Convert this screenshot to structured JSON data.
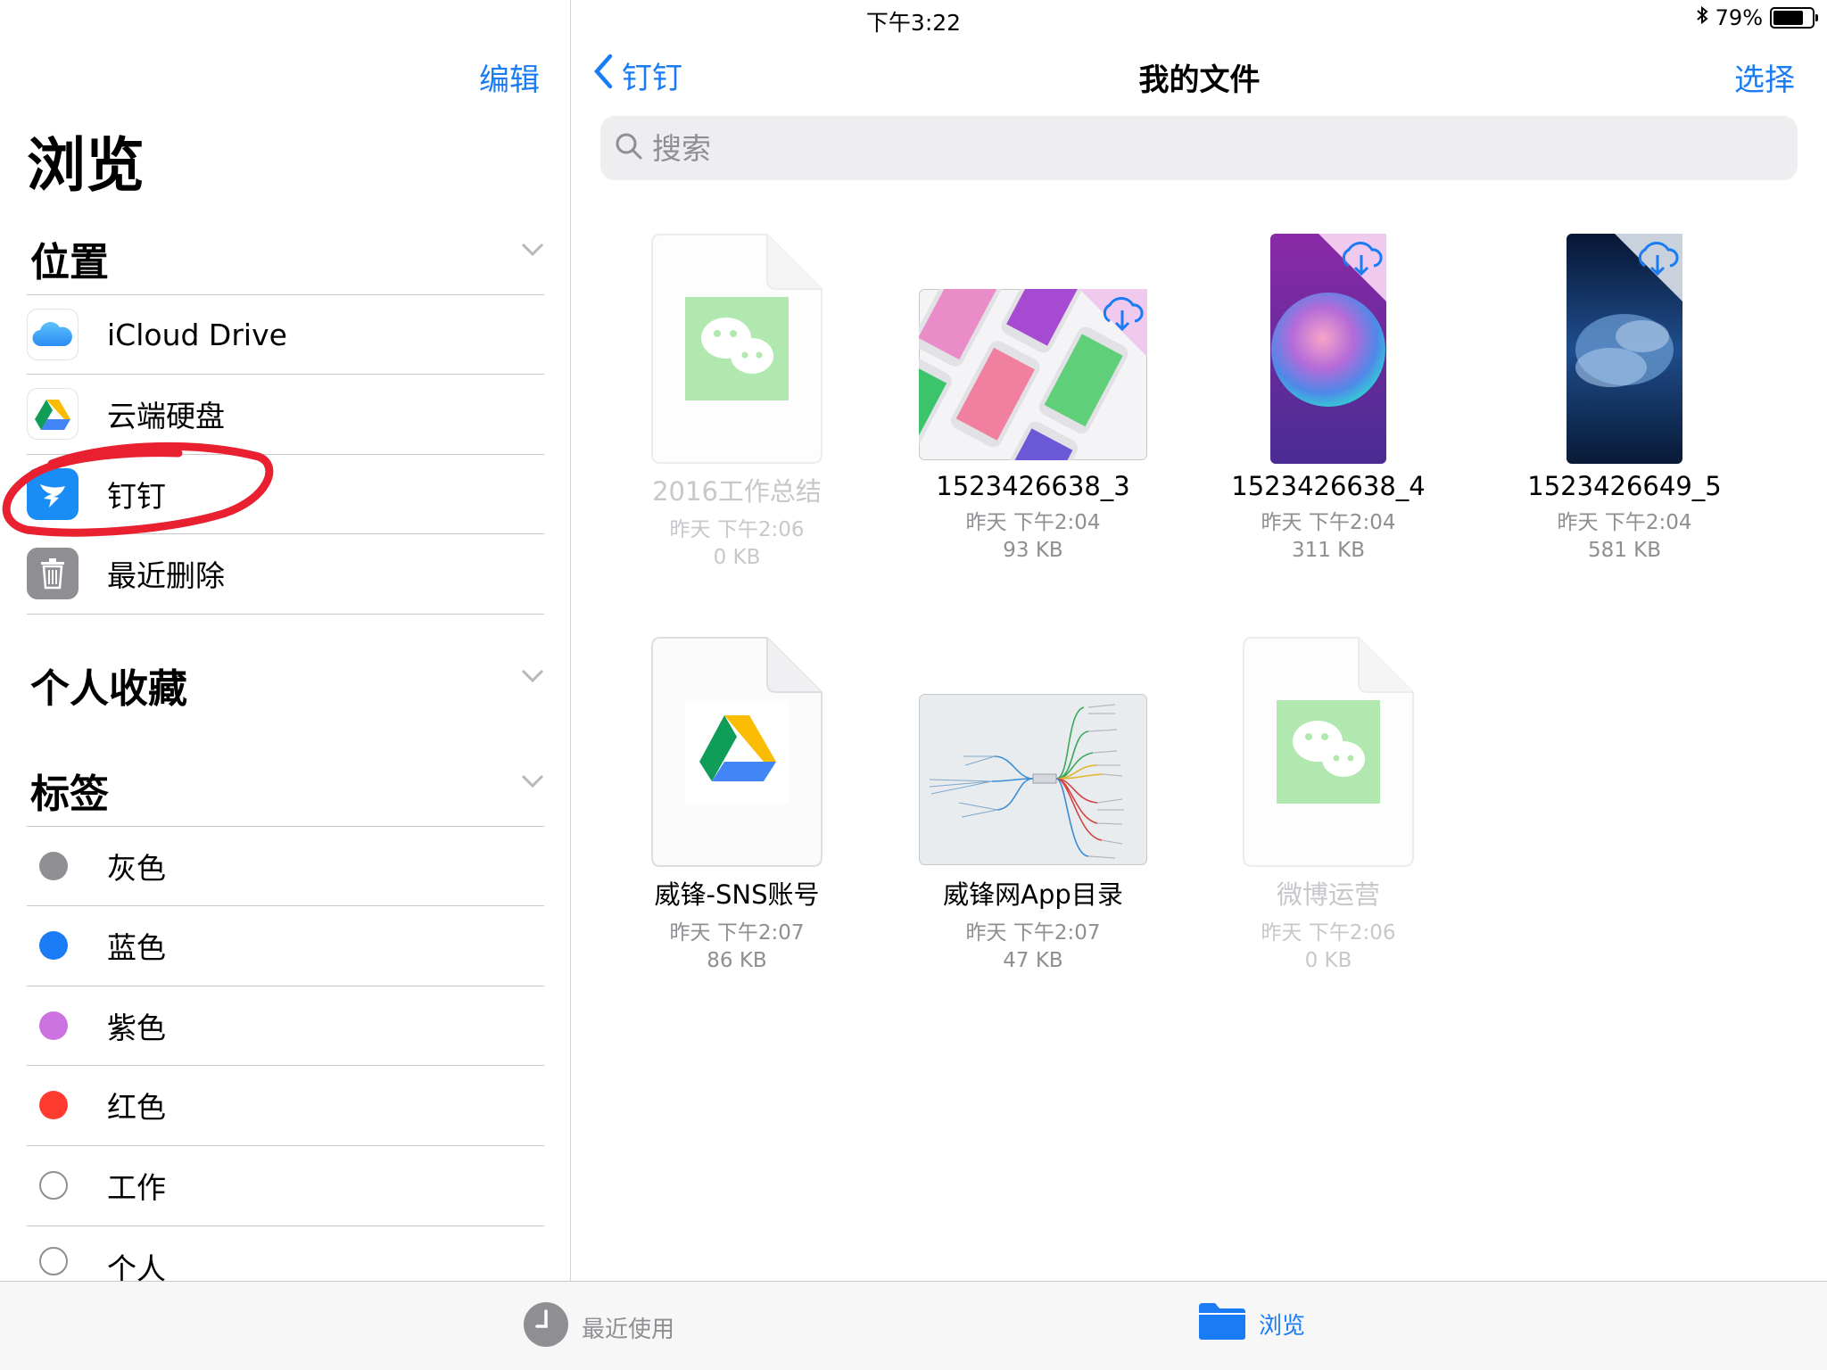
{
  "status": {
    "device": "iPad",
    "time": "下午3:22",
    "battery": "79%",
    "battery_level": 0.79
  },
  "sidebar": {
    "edit_label": "编辑",
    "title": "浏览",
    "locations_header": "位置",
    "locations": [
      {
        "label": "iCloud Drive",
        "icon": "icloud-icon"
      },
      {
        "label": "云端硬盘",
        "icon": "google-drive-icon"
      },
      {
        "label": "钉钉",
        "icon": "dingtalk-icon"
      },
      {
        "label": "最近删除",
        "icon": "trash-icon"
      }
    ],
    "favorites_header": "个人收藏",
    "tags_header": "标签",
    "tags": [
      {
        "label": "灰色",
        "color": "#8e8e93"
      },
      {
        "label": "蓝色",
        "color": "#1a7cf5"
      },
      {
        "label": "紫色",
        "color": "#cc73e1"
      },
      {
        "label": "红色",
        "color": "#ff3b30"
      },
      {
        "label": "工作",
        "color": ""
      },
      {
        "label": "个人",
        "color": ""
      }
    ]
  },
  "main": {
    "back_label": "钉钉",
    "title": "我的文件",
    "select_label": "选择",
    "search_placeholder": "搜索",
    "files": [
      {
        "name": "2016工作总结",
        "date": "昨天 下午2:06",
        "size": "0 KB",
        "kind": "wechat-doc",
        "dimmed": true
      },
      {
        "name": "1523426638_3",
        "date": "昨天 下午2:04",
        "size": "93 KB",
        "kind": "phones-image",
        "dimmed": false
      },
      {
        "name": "1523426638_4",
        "date": "昨天 下午2:04",
        "size": "311 KB",
        "kind": "sphere-wallpaper",
        "dimmed": false
      },
      {
        "name": "1523426649_5",
        "date": "昨天 下午2:04",
        "size": "581 KB",
        "kind": "space-wallpaper",
        "dimmed": false
      },
      {
        "name": "威锋-SNS账号",
        "date": "昨天 下午2:07",
        "size": "86 KB",
        "kind": "drive-doc",
        "dimmed": false
      },
      {
        "name": "威锋网App目录",
        "date": "昨天 下午2:07",
        "size": "47 KB",
        "kind": "mindmap-image",
        "dimmed": false
      },
      {
        "name": "微博运营",
        "date": "昨天 下午2:06",
        "size": "0 KB",
        "kind": "wechat-doc",
        "dimmed": true
      }
    ]
  },
  "tabbar": {
    "recents_label": "最近使用",
    "browse_label": "浏览"
  },
  "colors": {
    "accent": "#1a7cf5",
    "annotation": "#e8202f"
  }
}
